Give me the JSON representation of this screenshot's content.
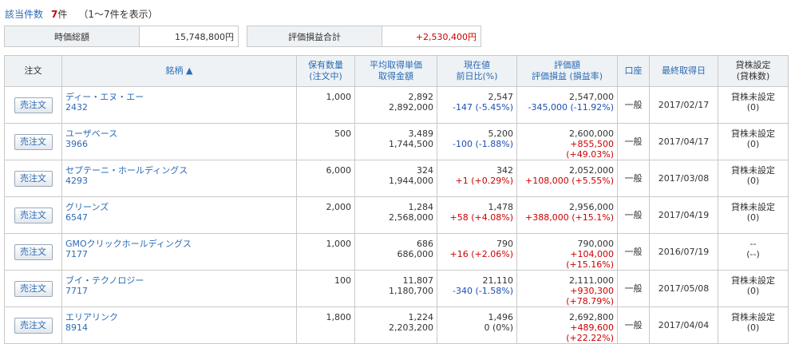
{
  "summary": {
    "count_label": "該当件数",
    "count_value": "7",
    "count_unit": "件",
    "range_text": "（1〜7件を表示）",
    "market_value_label": "時価総額",
    "market_value": "15,748,800円",
    "pl_total_label": "評価損益合計",
    "pl_total": "+2,530,400円"
  },
  "headers": {
    "order": "注文",
    "name": "銘柄 ▲",
    "qty_1": "保有数量",
    "qty_2": "(注文中)",
    "avg_1": "平均取得単価",
    "avg_2": "取得金額",
    "price_1": "現在値",
    "price_2": "前日比(%)",
    "eval_1": "評価額",
    "eval_2": "評価損益 (損益率)",
    "account": "口座",
    "last_date": "最終取得日",
    "lend_1": "貸株設定",
    "lend_2": "(貸株数)"
  },
  "rows": [
    {
      "button": "売注文",
      "name": "ディー・エヌ・エー",
      "code": "2432",
      "qty": "1,000",
      "avg": "2,892",
      "cost": "2,892,000",
      "price": "2,547",
      "change": "-147 (-5.45%)",
      "change_sign": "neg",
      "eval": "2,547,000",
      "pl": "-345,000 (-11.92%)",
      "pl_sign": "neg",
      "account": "一般",
      "date": "2017/02/17",
      "lend_1": "貸株未設定",
      "lend_2": "(0)"
    },
    {
      "button": "売注文",
      "name": "ユーザベース",
      "code": "3966",
      "qty": "500",
      "avg": "3,489",
      "cost": "1,744,500",
      "price": "5,200",
      "change": "-100 (-1.88%)",
      "change_sign": "neg",
      "eval": "2,600,000",
      "pl": "+855,500 (+49.03%)",
      "pl_sign": "pos",
      "account": "一般",
      "date": "2017/04/17",
      "lend_1": "貸株未設定",
      "lend_2": "(0)"
    },
    {
      "button": "売注文",
      "name": "セプテーニ・ホールディングス",
      "code": "4293",
      "qty": "6,000",
      "avg": "324",
      "cost": "1,944,000",
      "price": "342",
      "change": "+1 (+0.29%)",
      "change_sign": "pos",
      "eval": "2,052,000",
      "pl": "+108,000 (+5.55%)",
      "pl_sign": "pos",
      "account": "一般",
      "date": "2017/03/08",
      "lend_1": "貸株未設定",
      "lend_2": "(0)"
    },
    {
      "button": "売注文",
      "name": "グリーンズ",
      "code": "6547",
      "qty": "2,000",
      "avg": "1,284",
      "cost": "2,568,000",
      "price": "1,478",
      "change": "+58 (+4.08%)",
      "change_sign": "pos",
      "eval": "2,956,000",
      "pl": "+388,000 (+15.1%)",
      "pl_sign": "pos",
      "account": "一般",
      "date": "2017/04/19",
      "lend_1": "貸株未設定",
      "lend_2": "(0)"
    },
    {
      "button": "売注文",
      "name": "GMOクリックホールディングス",
      "code": "7177",
      "qty": "1,000",
      "avg": "686",
      "cost": "686,000",
      "price": "790",
      "change": "+16 (+2.06%)",
      "change_sign": "pos",
      "eval": "790,000",
      "pl": "+104,000 (+15.16%)",
      "pl_sign": "pos",
      "account": "一般",
      "date": "2016/07/19",
      "lend_1": "--",
      "lend_2": "(--)"
    },
    {
      "button": "売注文",
      "name": "ブイ・テクノロジー",
      "code": "7717",
      "qty": "100",
      "avg": "11,807",
      "cost": "1,180,700",
      "price": "21,110",
      "change": "-340 (-1.58%)",
      "change_sign": "neg",
      "eval": "2,111,000",
      "pl": "+930,300 (+78.79%)",
      "pl_sign": "pos",
      "account": "一般",
      "date": "2017/05/08",
      "lend_1": "貸株未設定",
      "lend_2": "(0)"
    },
    {
      "button": "売注文",
      "name": "エリアリンク",
      "code": "8914",
      "qty": "1,800",
      "avg": "1,224",
      "cost": "2,203,200",
      "price": "1,496",
      "change": "0 (0%)",
      "change_sign": "none",
      "eval": "2,692,800",
      "pl": "+489,600 (+22.22%)",
      "pl_sign": "pos",
      "account": "一般",
      "date": "2017/04/04",
      "lend_1": "貸株未設定",
      "lend_2": "(0)"
    }
  ]
}
